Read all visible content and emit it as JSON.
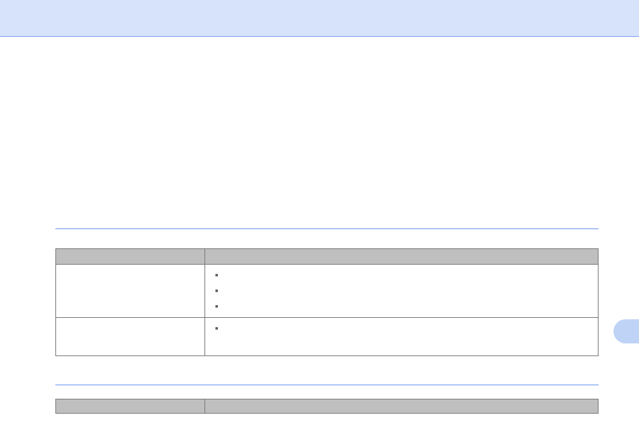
{
  "top_band": {},
  "sections": [
    {
      "headers": [
        "",
        ""
      ],
      "rows": [
        {
          "label": "",
          "bullets": [
            "",
            "",
            ""
          ]
        },
        {
          "label": "",
          "bullets": [
            ""
          ]
        }
      ]
    },
    {
      "headers": [
        "",
        ""
      ]
    }
  ]
}
